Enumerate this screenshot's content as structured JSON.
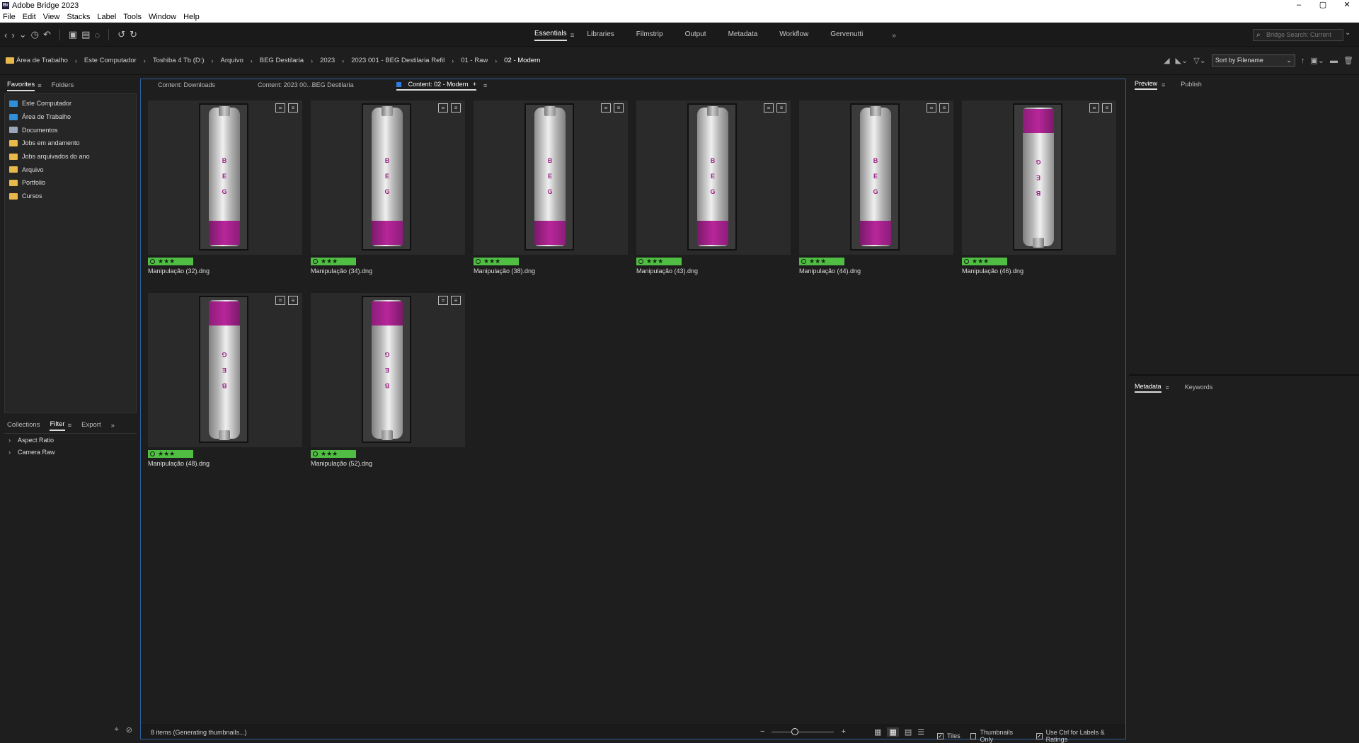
{
  "window": {
    "title": "Adobe Bridge 2023",
    "icon_text": "Br",
    "controls": [
      "–",
      "▢",
      "✕"
    ]
  },
  "menu": [
    "File",
    "Edit",
    "View",
    "Stacks",
    "Label",
    "Tools",
    "Window",
    "Help"
  ],
  "workspaces": {
    "items": [
      "Essentials",
      "Libraries",
      "Filmstrip",
      "Output",
      "Metadata",
      "Workflow",
      "Gervenutti"
    ],
    "active": "Essentials",
    "more": "»"
  },
  "search": {
    "placeholder": "Bridge Search: Current"
  },
  "breadcrumb": [
    "Área de Trabalho",
    "Este Computador",
    "Toshiba 4 Tb (D:)",
    "Arquivo",
    "BEG Destilaria",
    "2023",
    "2023 001 - BEG Destilaria Refil",
    "01 - Raw",
    "02 - Modern"
  ],
  "sort": {
    "label": "Sort by Filename"
  },
  "left_panel": {
    "tabs": [
      "Favorites",
      "Folders"
    ],
    "favorites": [
      {
        "label": "Este Computador",
        "color": "blue"
      },
      {
        "label": "Área de Trabalho",
        "color": "blue"
      },
      {
        "label": "Documentos",
        "color": "gray"
      },
      {
        "label": "Jobs em andamento",
        "color": "yellow"
      },
      {
        "label": "Jobs arquivados do ano",
        "color": "yellow"
      },
      {
        "label": "Arquivo",
        "color": "yellow"
      },
      {
        "label": "Portfolio",
        "color": "yellow"
      },
      {
        "label": "Cursos",
        "color": "yellow"
      }
    ],
    "lower_tabs": [
      "Collections",
      "Filter",
      "Export"
    ],
    "filters": [
      "Aspect Ratio",
      "Camera Raw"
    ]
  },
  "content": {
    "tabs": [
      "Content: Downloads",
      "Content: 2023 00...BEG Destilaria",
      "Content: 02 - Modern"
    ],
    "files": [
      {
        "name": "Manipulação (32).dng",
        "rating": "★★★",
        "flipped": false
      },
      {
        "name": "Manipulação (34).dng",
        "rating": "★★★",
        "flipped": false
      },
      {
        "name": "Manipulação (38).dng",
        "rating": "★★★",
        "flipped": false
      },
      {
        "name": "Manipulação (43).dng",
        "rating": "★★★",
        "flipped": false
      },
      {
        "name": "Manipulação (44).dng",
        "rating": "★★★",
        "flipped": false
      },
      {
        "name": "Manipulação (46).dng",
        "rating": "★★★",
        "flipped": true
      },
      {
        "name": "Manipulação (48).dng",
        "rating": "★★★",
        "flipped": true
      },
      {
        "name": "Manipulação (52).dng",
        "rating": "★★★",
        "flipped": true
      }
    ],
    "status": "8 items (Generating thumbnails...)",
    "options": [
      {
        "label": "Tiles",
        "checked": true
      },
      {
        "label": "Thumbnails Only",
        "checked": false
      },
      {
        "label": "Use Ctrl for Labels & Ratings",
        "checked": true
      }
    ]
  },
  "right_panel": {
    "top_tabs": [
      "Preview",
      "Publish"
    ],
    "bottom_tabs": [
      "Metadata",
      "Keywords"
    ]
  }
}
